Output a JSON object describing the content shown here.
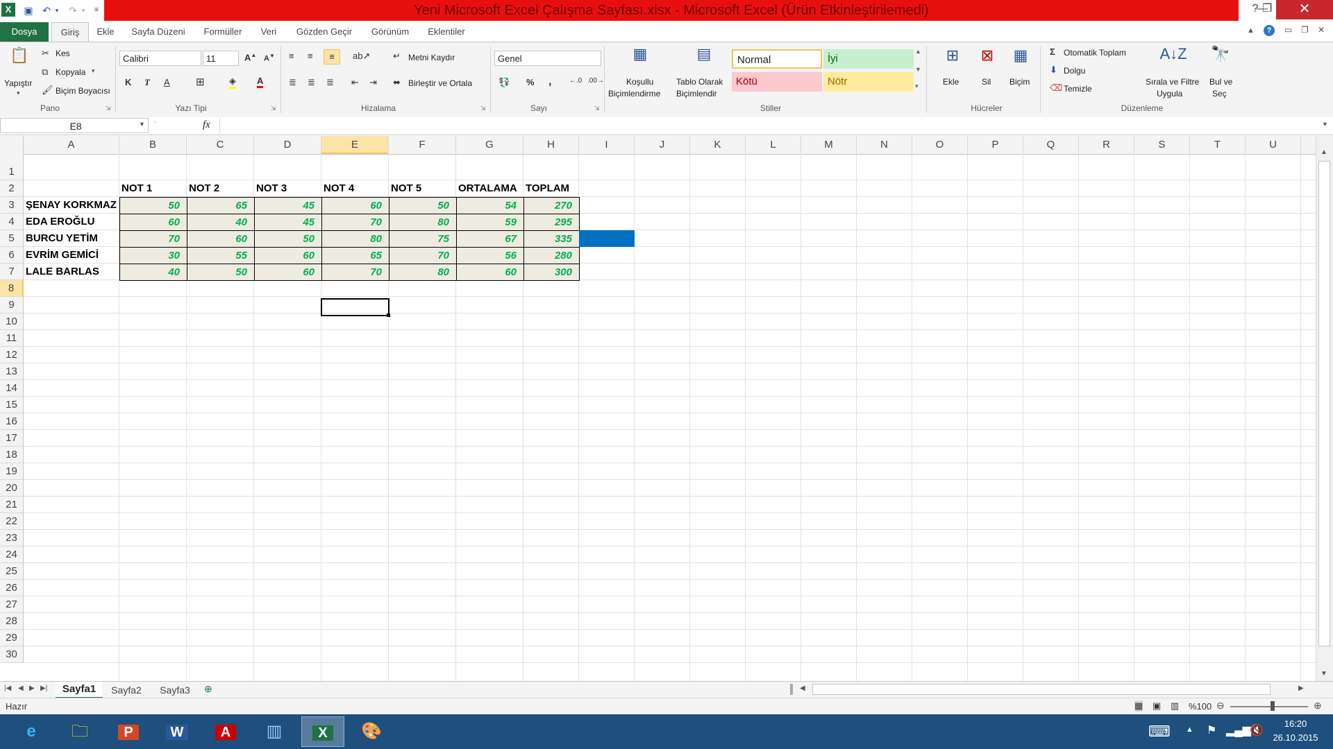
{
  "window": {
    "title": "Yeni Microsoft Excel Çalışma Sayfası.xlsx - Microsoft Excel (Ürün Etkinleştirilemedi)",
    "minimize": "—",
    "restore": "❐",
    "close": "✕"
  },
  "tabs": [
    "Dosya",
    "Giriş",
    "Ekle",
    "Sayfa Düzeni",
    "Formüller",
    "Veri",
    "Gözden Geçir",
    "Görünüm",
    "Eklentiler"
  ],
  "ribbon": {
    "pano": {
      "label": "Pano",
      "paste": "Yapıştır",
      "cut": "Kes",
      "copy": "Kopyala",
      "format_painter": "Biçim Boyacısı"
    },
    "font": {
      "label": "Yazı Tipi",
      "name": "Calibri",
      "size": "11",
      "bold": "K",
      "italic": "T",
      "underline": "A",
      "font_color": "A"
    },
    "align": {
      "label": "Hizalama",
      "wrap": "Metni Kaydır",
      "merge": "Birleştir ve Ortala"
    },
    "number": {
      "label": "Sayı",
      "format": "Genel",
      "percent": "%",
      "comma": ","
    },
    "styles": {
      "label": "Stiller",
      "cond_format": [
        "Koşullu",
        "Biçimlendirme"
      ],
      "table_format": [
        "Tablo Olarak",
        "Biçimlendir"
      ],
      "normal": "Normal",
      "good": "İyi",
      "bad": "Kötü",
      "neutral": "Nötr"
    },
    "cells": {
      "label": "Hücreler",
      "insert": "Ekle",
      "delete": "Sil",
      "format": "Biçim"
    },
    "editing": {
      "label": "Düzenleme",
      "autosum": "Otomatik Toplam",
      "fill": "Dolgu",
      "clear": "Temizle",
      "sort": [
        "Sırala ve Filtre",
        "Uygula"
      ],
      "find": [
        "Bul ve",
        "Seç"
      ]
    }
  },
  "formula_bar": {
    "name_box": "E8",
    "fx": "fx",
    "value": ""
  },
  "columns": [
    "A",
    "B",
    "C",
    "D",
    "E",
    "F",
    "G",
    "H",
    "I",
    "J",
    "K",
    "L",
    "M",
    "N",
    "O",
    "P",
    "Q",
    "R",
    "S",
    "T",
    "U"
  ],
  "rows": [
    "1",
    "2",
    "3",
    "4",
    "5",
    "6",
    "7",
    "8",
    "9",
    "10",
    "11",
    "12",
    "13",
    "14",
    "15",
    "16",
    "17",
    "18",
    "19",
    "20",
    "21",
    "22",
    "23",
    "24",
    "25",
    "26",
    "27",
    "28",
    "29",
    "30"
  ],
  "table": {
    "headers": [
      "NOT 1",
      "NOT 2",
      "NOT 3",
      "NOT 4",
      "NOT 5",
      "ORTALAMA",
      "TOPLAM"
    ],
    "rows": [
      {
        "name": "ŞENAY KORKMAZ",
        "values": [
          "50",
          "65",
          "45",
          "60",
          "50",
          "54",
          "270"
        ]
      },
      {
        "name": "EDA EROĞLU",
        "values": [
          "60",
          "40",
          "45",
          "70",
          "80",
          "59",
          "295"
        ]
      },
      {
        "name": "BURCU YETİM",
        "values": [
          "70",
          "60",
          "50",
          "80",
          "75",
          "67",
          "335"
        ]
      },
      {
        "name": "EVRİM GEMİCİ",
        "values": [
          "30",
          "55",
          "60",
          "65",
          "70",
          "56",
          "280"
        ]
      },
      {
        "name": "LALE BARLAS",
        "values": [
          "40",
          "50",
          "60",
          "70",
          "80",
          "60",
          "300"
        ]
      }
    ]
  },
  "active_cell": "E8",
  "sheets": [
    "Sayfa1",
    "Sayfa2",
    "Sayfa3"
  ],
  "status": {
    "ready": "Hazır",
    "zoom": "%100"
  },
  "taskbar": {
    "time": "16:20",
    "date": "26.10.2015"
  },
  "colors": {
    "excel_green": "#207245",
    "title_red": "#e8100f",
    "number_green": "#00b050",
    "cell_fill": "#eeece1",
    "selected_fill": "#0070c0"
  }
}
